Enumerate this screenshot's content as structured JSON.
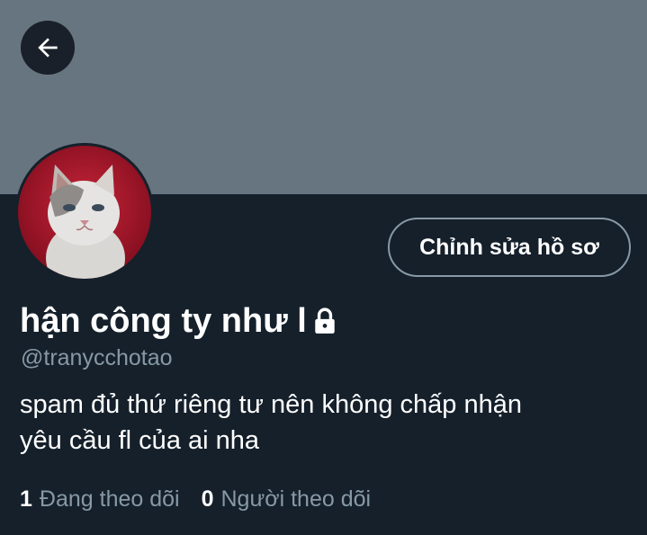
{
  "header": {
    "back_icon": "arrow-left-icon",
    "banner_color": "#66757f"
  },
  "profile": {
    "avatar_icon": "cat-avatar",
    "display_name": "hận công ty như l",
    "lock_icon": "lock-icon",
    "handle": "@tranycchotao",
    "bio_line1": "spam đủ thứ riêng tư nên không chấp nhận",
    "bio_line2": "yêu cầu fl của ai nha",
    "edit_button_label": "Chỉnh sửa hồ sơ"
  },
  "stats": {
    "following_count": "1",
    "following_label": "Đang theo dõi",
    "followers_count": "0",
    "followers_label": "Người theo dõi"
  },
  "colors": {
    "background": "#15202b",
    "text_primary": "#ffffff",
    "text_secondary": "#8899a6",
    "button_border": "#8899a6"
  }
}
